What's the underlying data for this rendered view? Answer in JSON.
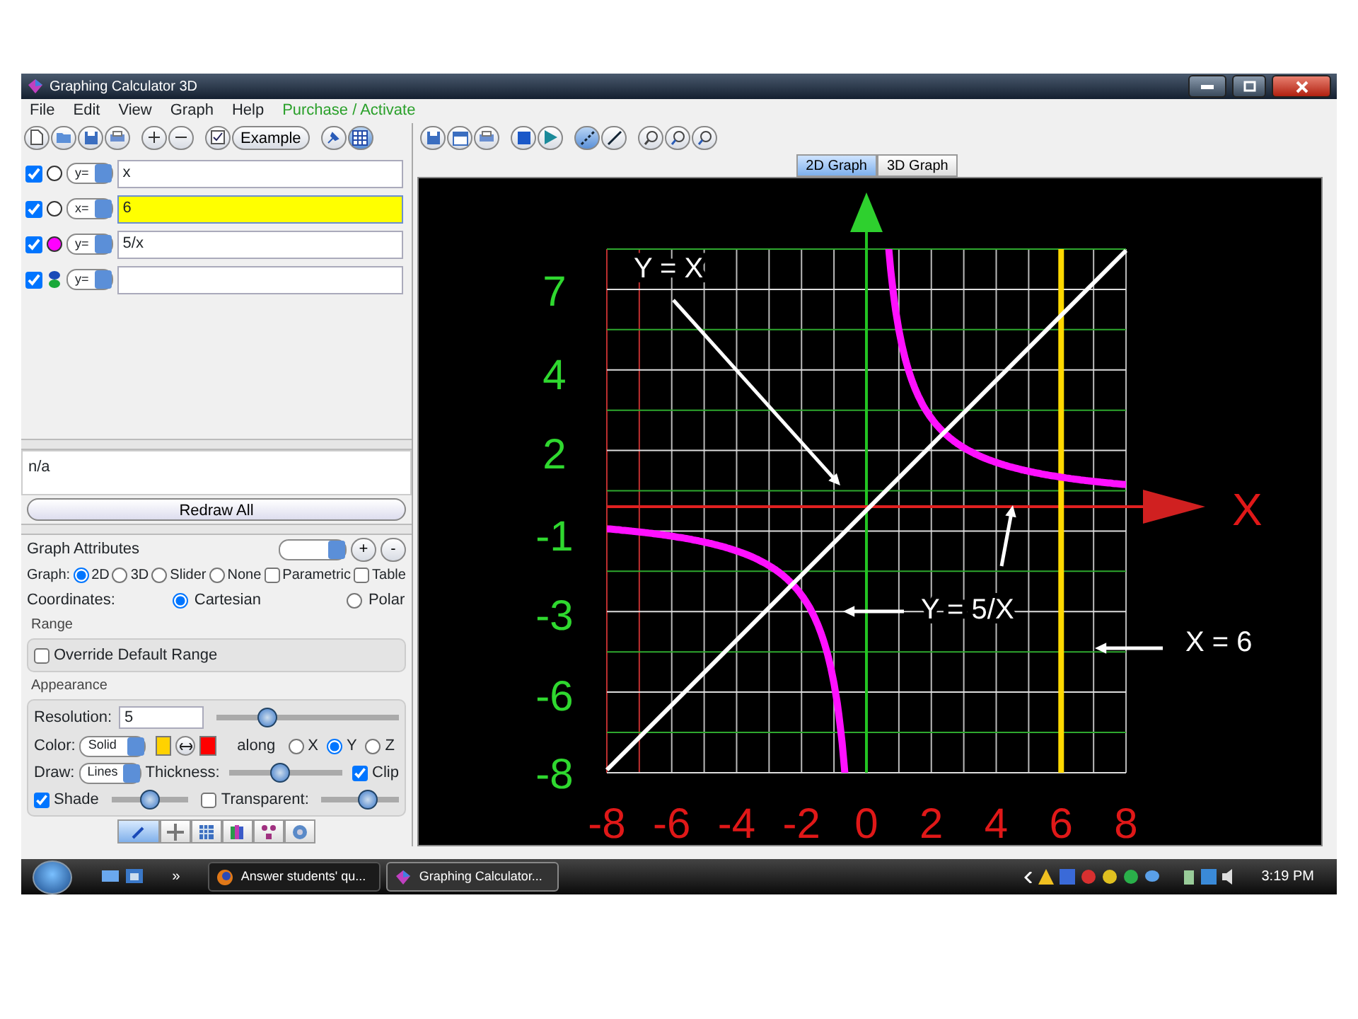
{
  "window": {
    "title": "Graphing Calculator 3D"
  },
  "menu": [
    {
      "label": "File",
      "kind": "menu"
    },
    {
      "label": "Edit",
      "kind": "menu"
    },
    {
      "label": "View",
      "kind": "menu"
    },
    {
      "label": "Graph",
      "kind": "menu"
    },
    {
      "label": "Help",
      "kind": "menu"
    },
    {
      "label": "Purchase / Activate",
      "kind": "link"
    }
  ],
  "toolbar": {
    "example_button": "Example"
  },
  "equations": [
    {
      "checked": true,
      "kind": "circle",
      "mode": "y=",
      "value": "x",
      "focused": false
    },
    {
      "checked": true,
      "kind": "circle",
      "mode": "x=",
      "value": "6",
      "focused": true
    },
    {
      "checked": true,
      "kind": "circle",
      "color": "#ff00ff",
      "mode": "y=",
      "value": "5/x",
      "focused": false
    },
    {
      "checked": true,
      "kind": "dots",
      "mode": "y=",
      "focused": false
    }
  ],
  "info": {
    "text": "n/a"
  },
  "redraw_button": "Redraw All",
  "attributes": {
    "title": "Graph Attributes",
    "add_button": "+",
    "remove_button": "-",
    "graph_label": "Graph:",
    "graph_types": [
      {
        "label": "2D",
        "selected": true
      },
      {
        "label": "3D",
        "selected": false
      },
      {
        "label": "Slider",
        "selected": false
      },
      {
        "label": "None",
        "selected": false
      }
    ],
    "options": [
      {
        "label": "Parametric",
        "checked": false
      },
      {
        "label": "Table",
        "checked": false
      }
    ],
    "coordinates_label": "Coordinates:",
    "coordinates": [
      {
        "label": "Cartesian",
        "selected": true
      },
      {
        "label": "Polar",
        "selected": false
      }
    ],
    "range_title": "Range",
    "override": {
      "label": "Override Default Range",
      "checked": false
    },
    "appearance_title": "Appearance",
    "resolution": {
      "label": "Resolution:",
      "value": "5",
      "level": 0.28
    },
    "color": {
      "label": "Color:",
      "mode": "Solid",
      "along_label": "along",
      "axes": [
        {
          "label": "X",
          "selected": false
        },
        {
          "label": "Y",
          "selected": true
        },
        {
          "label": "Z",
          "selected": false
        }
      ]
    },
    "draw": {
      "label": "Draw:",
      "mode": "Lines",
      "thickness_label": "Thickness:",
      "level": 0.45,
      "clip": {
        "label": "Clip",
        "checked": true
      }
    },
    "shade": {
      "label": "Shade",
      "checked": true,
      "level": 0.5
    },
    "transparent": {
      "label": "Transparent:",
      "checked": false,
      "level": 0.6
    },
    "bottom_tabs": [
      {
        "selected": true
      },
      {
        "selected": false
      },
      {
        "selected": false
      },
      {
        "selected": false
      },
      {
        "selected": false
      },
      {
        "selected": false
      }
    ]
  },
  "graph_tabs": [
    {
      "label": "2D Graph",
      "selected": true
    },
    {
      "label": "3D Graph",
      "selected": false
    }
  ],
  "graph": {
    "y_labels": [
      "7",
      "4",
      "2",
      "-1",
      "-3",
      "-6",
      "-8"
    ],
    "x_labels": [
      "-8",
      "-6",
      "-4",
      "-2",
      "0",
      "2",
      "4",
      "6",
      "8"
    ],
    "axis_label": "X",
    "annotations": [
      {
        "text": "Y = X"
      },
      {
        "text": "Y = 5/X"
      },
      {
        "text": "X = 6"
      }
    ]
  },
  "taskbar": {
    "chevron": "»",
    "items": [
      {
        "label": "Answer students' qu...",
        "selected": false
      },
      {
        "label": "Graphing Calculator...",
        "selected": true
      }
    ],
    "clock": "3:19 PM"
  }
}
